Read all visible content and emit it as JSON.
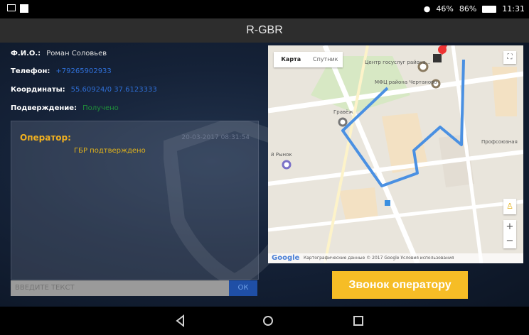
{
  "status_bar": {
    "signal_text": "46%",
    "battery_text": "86%",
    "time": "11:31"
  },
  "app": {
    "title": "R-GBR"
  },
  "info": {
    "fio_label": "Ф.И.О.:",
    "fio_value": "Роман Соловьев",
    "phone_label": "Телефон:",
    "phone_value": "+79265902933",
    "coords_label": "Координаты:",
    "coords_value": "55.60924/0 37.6123333",
    "confirm_label": "Подверждение:",
    "confirm_value": "Получено"
  },
  "chat": {
    "operator_label": "Оператор:",
    "operator_time": "20-03-2017 08:31:54",
    "operator_message": "ГБР подтверждено"
  },
  "input": {
    "placeholder": "ВВЕДИТЕ ТЕКСТ",
    "send_label": "ОК"
  },
  "map": {
    "tab_map": "Карта",
    "tab_satellite": "Спутник",
    "labels": {
      "center": "Центр госуслуг района...",
      "mfc": "МФЦ района Чертаново",
      "flag": "Гравёж",
      "profsoyuz": "Профсоюзная",
      "market": "й Рынок"
    },
    "footer_logo": "Google",
    "footer_attr": "Картографические данные © 2017 Google   Условия использования"
  },
  "call_button": {
    "label": "Звонок оператору"
  },
  "colors": {
    "accent_yellow": "#f6bd26",
    "route_blue": "#4a90e2",
    "link_blue": "#2f6fd6",
    "confirm_green": "#1f8f3a"
  }
}
